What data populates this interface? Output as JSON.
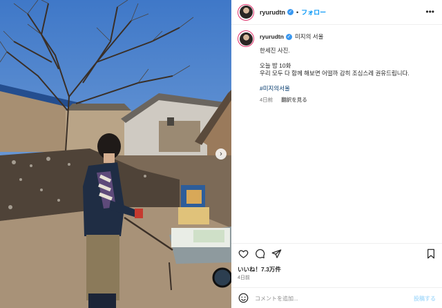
{
  "post": {
    "username": "ryurudtn",
    "follow_label": "フォロー",
    "separator": "•",
    "more_label": "•••",
    "next_label": "›",
    "caption": {
      "author": "ryurudtn",
      "first_line": "미지의 서울",
      "lines": [
        "한세진 사진.",
        "",
        "오늘 밤 10화",
        "우리 모두 다 함께 해보면 어떨까 감히 조심스레 권유드립니다.",
        "",
        "#미지의서울"
      ],
      "time": "4日前",
      "translate_label": "翻訳を見る"
    },
    "likes": "いいね！7.3万件",
    "date": "4日前",
    "comment": {
      "placeholder": "コメントを追加...",
      "post_label": "投稿する"
    }
  },
  "colors": {
    "accent": "#0095f6",
    "hashtag": "#00376b",
    "muted": "#737373",
    "verified": "#3897f0"
  },
  "icons": [
    "heart-icon",
    "comment-icon",
    "share-icon",
    "bookmark-icon",
    "emoji-icon",
    "verified-icon",
    "more-icon",
    "chevron-right-icon"
  ]
}
